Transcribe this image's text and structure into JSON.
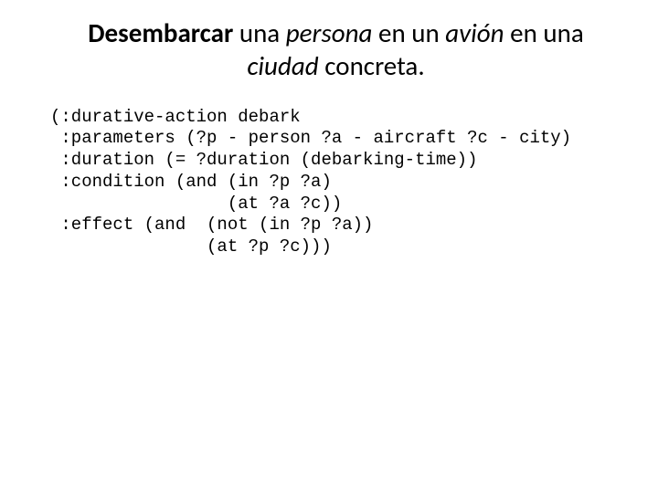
{
  "title": {
    "t1_bold": "Desembarcar",
    "t2": " una ",
    "t3_i": "persona",
    "t4": " en un ",
    "t5_i": "avión",
    "t6": " en una ",
    "t7_i": "ciudad",
    "t8": " concreta."
  },
  "code": {
    "l1": "(:durative-action debark",
    "l2": " :parameters (?p - person ?a - aircraft ?c - city)",
    "l3": " :duration (= ?duration (debarking-time))",
    "l4": " :condition (and (in ?p ?a)",
    "l5": "                 (at ?a ?c))",
    "l6": " :effect (and  (not (in ?p ?a))",
    "l7": "               (at ?p ?c)))"
  }
}
